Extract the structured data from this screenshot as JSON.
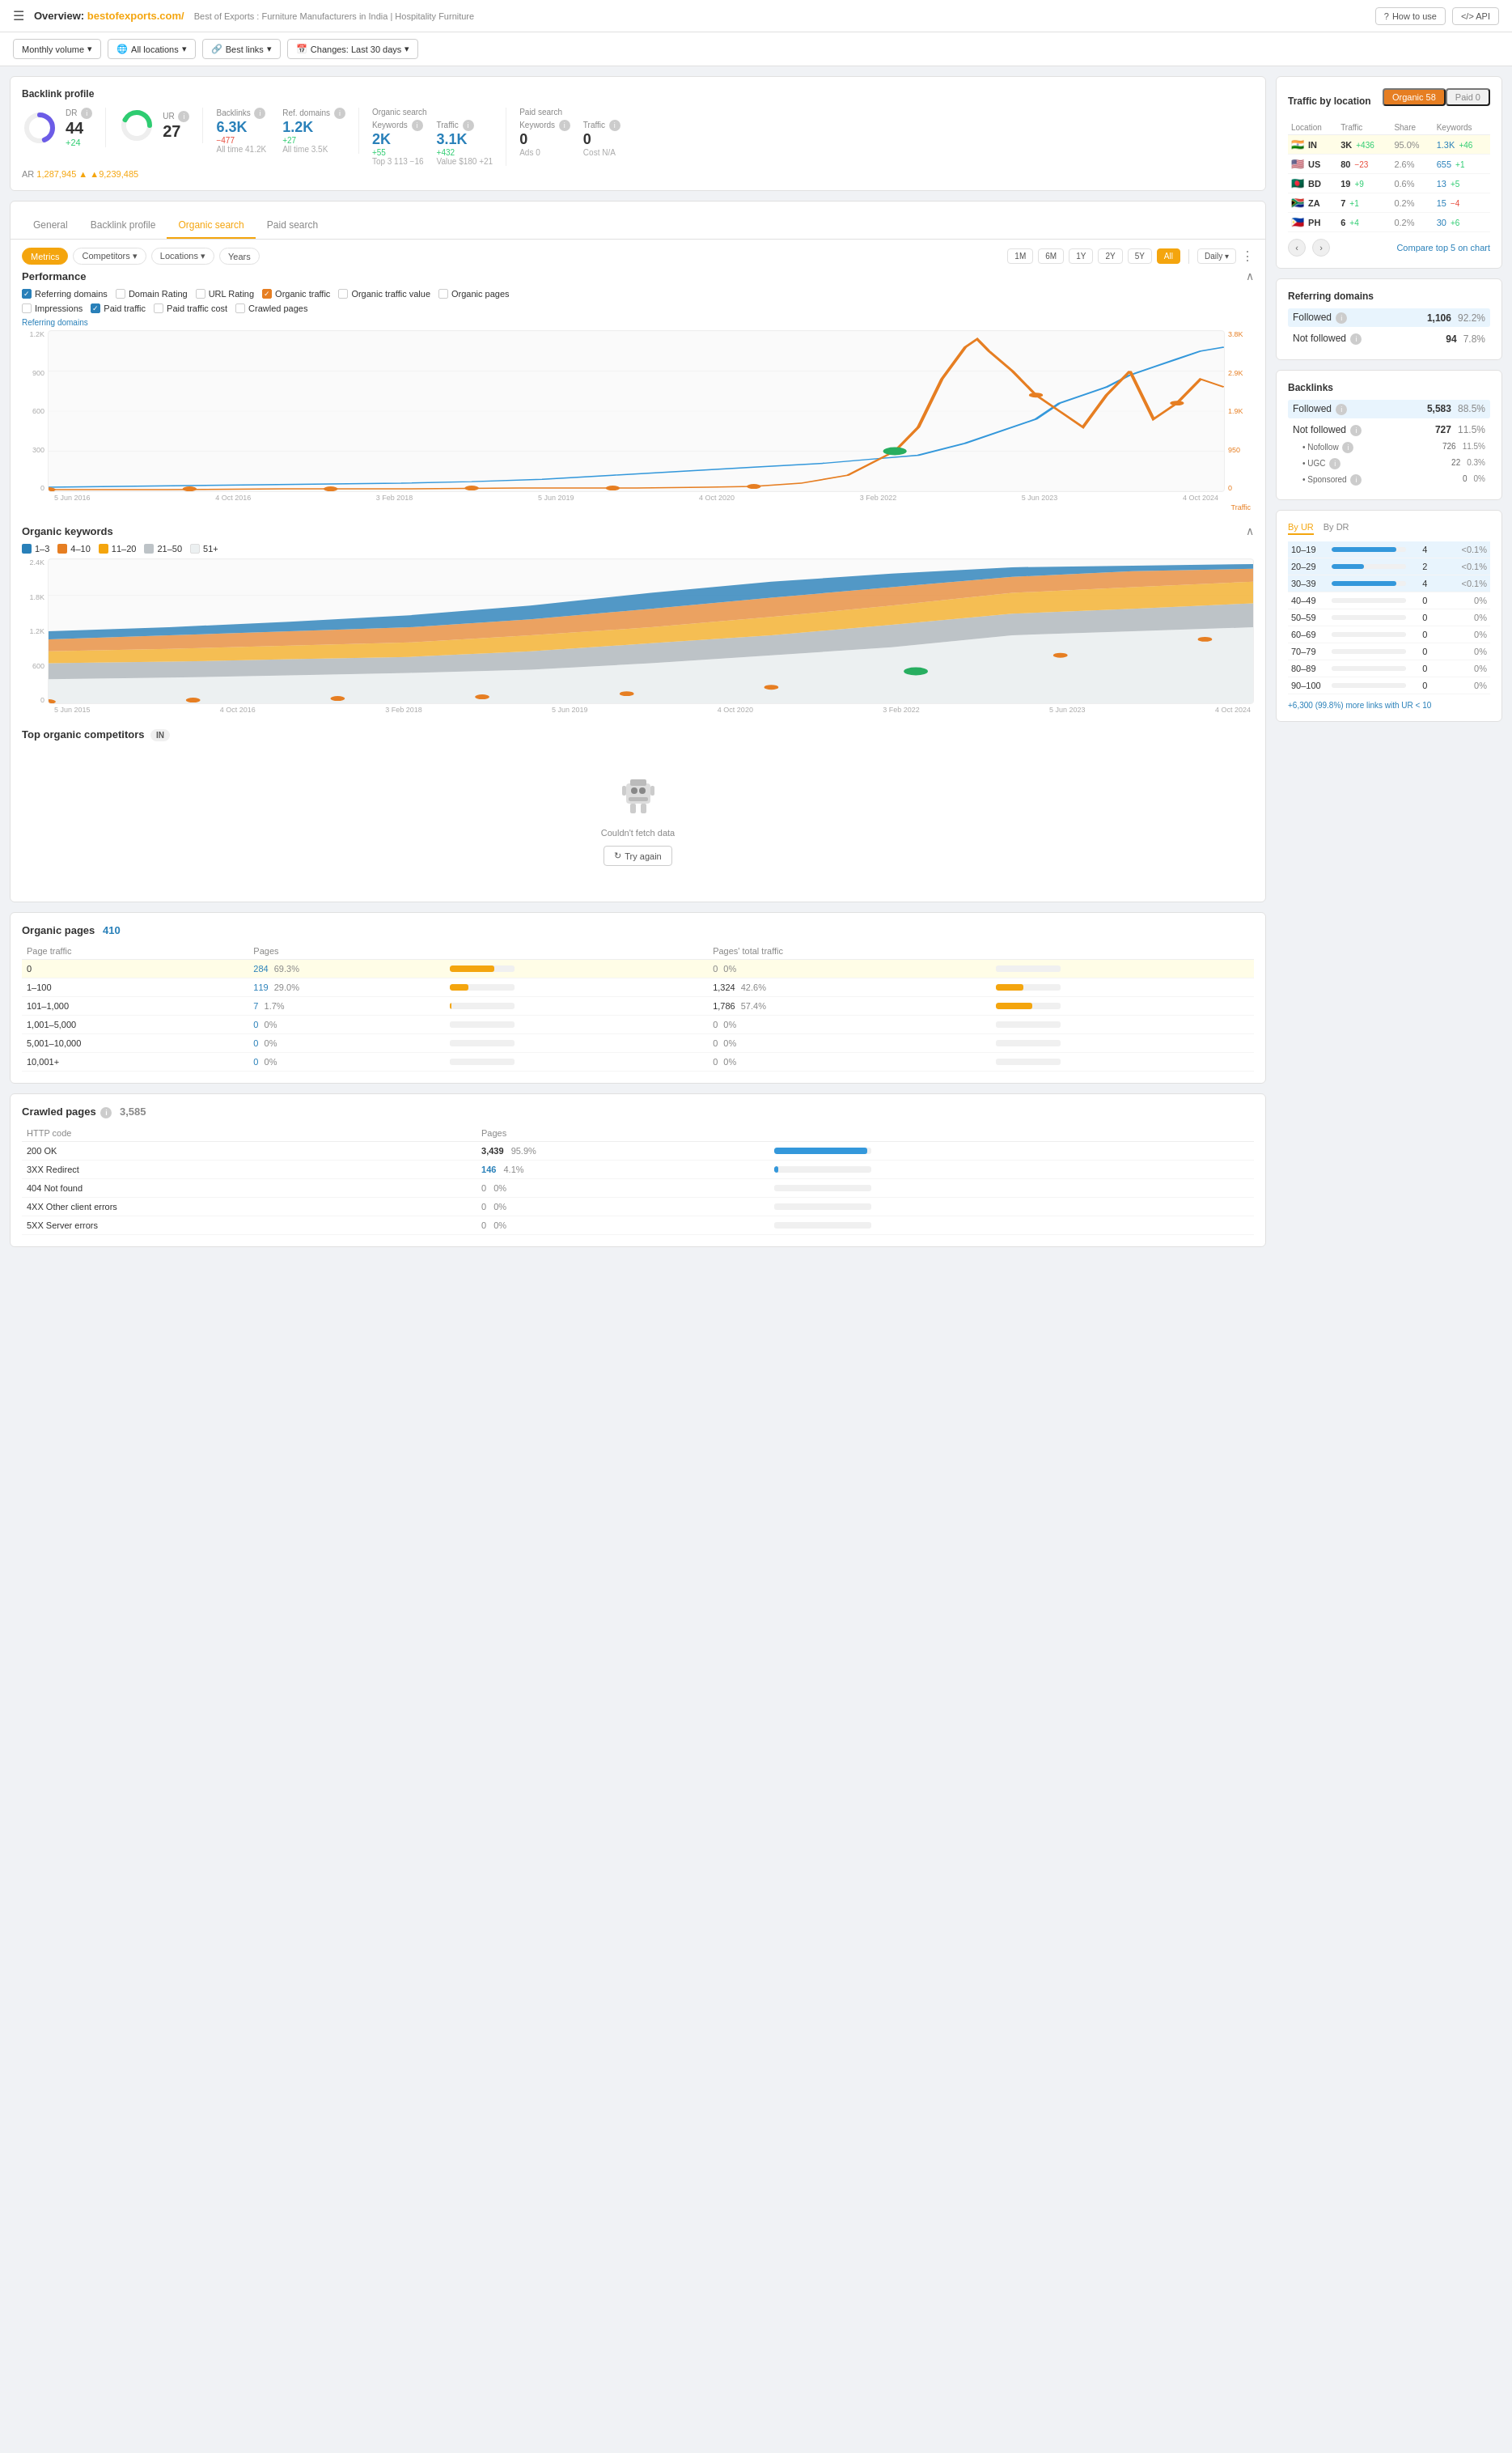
{
  "header": {
    "overview_label": "Overview:",
    "domain": "bestofexports.com/",
    "breadcrumb": "Best of Exports : Furniture Manufacturers in India | Hospitality Furniture",
    "how_to_use": "How to use",
    "api_label": "API"
  },
  "filters": {
    "monthly_volume": "Monthly volume",
    "all_locations": "All locations",
    "best_links": "Best links",
    "changes": "Changes: Last 30 days"
  },
  "backlink_profile": {
    "title": "Backlink profile",
    "dr_label": "DR",
    "dr_value": "44",
    "dr_change": "+24",
    "ur_label": "UR",
    "ur_value": "27",
    "ar_label": "AR",
    "ar_value": "1,287,945",
    "ar_change": "▲9,239,485",
    "backlinks_label": "Backlinks",
    "backlinks_value": "6.3K",
    "backlinks_change": "−477",
    "backlinks_alltime": "All time 41.2K",
    "ref_domains_label": "Ref. domains",
    "ref_domains_value": "1.2K",
    "ref_domains_change": "+27",
    "ref_domains_alltime": "All time 3.5K"
  },
  "organic_search": {
    "title": "Organic search",
    "keywords_label": "Keywords",
    "keywords_value": "2K",
    "keywords_change": "+55",
    "keywords_top3": "Top 3  113  −16",
    "traffic_label": "Traffic",
    "traffic_value": "3.1K",
    "traffic_change": "+432",
    "traffic_value_label": "Value $180  +21"
  },
  "paid_search": {
    "title": "Paid search",
    "keywords_label": "Keywords",
    "keywords_value": "0",
    "ads_label": "Ads 0",
    "traffic_label": "Traffic",
    "traffic_value": "0",
    "cost_label": "Cost N/A"
  },
  "tabs": [
    "General",
    "Backlink profile",
    "Organic search",
    "Paid search"
  ],
  "active_tab": "General",
  "chart_controls": {
    "period_buttons": [
      "1M",
      "6M",
      "1Y",
      "2Y",
      "5Y",
      "All"
    ],
    "active_period": "All",
    "freq_options": [
      "Daily"
    ],
    "pill_tabs": [
      "Metrics",
      "Competitors",
      "Locations",
      "Years"
    ],
    "active_pill": "Metrics"
  },
  "performance": {
    "title": "Performance",
    "checkboxes": [
      {
        "label": "Referring domains",
        "checked": true,
        "color": "blue"
      },
      {
        "label": "Domain Rating",
        "checked": false,
        "color": "gray"
      },
      {
        "label": "URL Rating",
        "checked": false,
        "color": "gray"
      },
      {
        "label": "Organic traffic",
        "checked": true,
        "color": "orange"
      },
      {
        "label": "Organic traffic value",
        "checked": false,
        "color": "gray"
      },
      {
        "label": "Organic pages",
        "checked": false,
        "color": "gray"
      },
      {
        "label": "Impressions",
        "checked": false,
        "color": "gray"
      },
      {
        "label": "Paid traffic",
        "checked": true,
        "color": "gray"
      },
      {
        "label": "Paid traffic cost",
        "checked": false,
        "color": "gray"
      },
      {
        "label": "Crawled pages",
        "checked": false,
        "color": "gray"
      }
    ],
    "y_axis_left": [
      "1.2K",
      "900",
      "600",
      "300",
      "0"
    ],
    "y_axis_right": [
      "3.8K",
      "2.9K",
      "1.9K",
      "950",
      "0"
    ],
    "x_axis": [
      "5 Jun 2016",
      "4 Oct 2016",
      "3 Feb 2018",
      "5 Jun 2019",
      "4 Oct 2020",
      "3 Feb 2022",
      "5 Jun 2023",
      "4 Oct 2024"
    ],
    "referring_label": "Referring domains",
    "traffic_label": "Traffic"
  },
  "organic_keywords": {
    "title": "Organic keywords",
    "legend": [
      {
        "label": "1–3",
        "color": "#2980b9"
      },
      {
        "label": "4–10",
        "color": "#e67e22"
      },
      {
        "label": "11–20",
        "color": "#f4a50e"
      },
      {
        "label": "21–50",
        "color": "#bdc3c7"
      },
      {
        "label": "51+",
        "color": "#ecf0f1"
      }
    ],
    "y_axis": [
      "2.4K",
      "1.8K",
      "1.2K",
      "600",
      "0"
    ],
    "x_axis": [
      "5 Jun 2015",
      "4 Oct 2016",
      "3 Feb 2018",
      "5 Jun 2019",
      "4 Oct 2020",
      "3 Feb 2022",
      "5 Jun 2023",
      "4 Oct 2024"
    ]
  },
  "top_competitors": {
    "title": "Top organic competitors",
    "location": "IN",
    "empty_message": "Couldn't fetch data",
    "try_again": "Try again"
  },
  "organic_pages": {
    "title": "Organic pages",
    "count": "410",
    "columns": [
      "Page traffic",
      "Pages",
      "",
      "Pages' total traffic",
      ""
    ],
    "rows": [
      {
        "traffic": "0",
        "pages": "284",
        "pages_pct": "69.3%",
        "total_traffic": "0",
        "total_pct": "0%",
        "bar_pages": 69,
        "bar_traffic": 0
      },
      {
        "traffic": "1–100",
        "pages": "119",
        "pages_pct": "29.0%",
        "total_traffic": "1,324",
        "total_pct": "42.6%",
        "bar_pages": 29,
        "bar_traffic": 43
      },
      {
        "traffic": "101–1,000",
        "pages": "7",
        "pages_pct": "1.7%",
        "total_traffic": "1,786",
        "total_pct": "57.4%",
        "bar_pages": 2,
        "bar_traffic": 57
      },
      {
        "traffic": "1,001–5,000",
        "pages": "0",
        "pages_pct": "0%",
        "total_traffic": "0",
        "total_pct": "0%",
        "bar_pages": 0,
        "bar_traffic": 0
      },
      {
        "traffic": "5,001–10,000",
        "pages": "0",
        "pages_pct": "0%",
        "total_traffic": "0",
        "total_pct": "0%",
        "bar_pages": 0,
        "bar_traffic": 0
      },
      {
        "traffic": "10,001+",
        "pages": "0",
        "pages_pct": "0%",
        "total_traffic": "0",
        "total_pct": "0%",
        "bar_pages": 0,
        "bar_traffic": 0
      }
    ]
  },
  "crawled_pages": {
    "title": "Crawled pages",
    "count": "3,585",
    "columns": [
      "HTTP code",
      "Pages",
      ""
    ],
    "rows": [
      {
        "code": "200 OK",
        "pages": "3,439",
        "pct": "95.9%",
        "bar": 96,
        "color": "#3498db"
      },
      {
        "code": "3XX Redirect",
        "pages": "146",
        "pct": "4.1%",
        "bar": 4,
        "color": "#3498db"
      },
      {
        "code": "404 Not found",
        "pages": "0",
        "pct": "0%",
        "bar": 0,
        "color": "#3498db"
      },
      {
        "code": "4XX Other client errors",
        "pages": "0",
        "pct": "0%",
        "bar": 0,
        "color": "#3498db"
      },
      {
        "code": "5XX Server errors",
        "pages": "0",
        "pct": "0%",
        "bar": 0,
        "color": "#3498db"
      }
    ]
  },
  "traffic_by_location": {
    "title": "Traffic by location",
    "tabs": [
      "Organic 58",
      "Paid 0"
    ],
    "active_tab": "Organic 58",
    "columns": [
      "Location",
      "Traffic",
      "Share",
      "Keywords"
    ],
    "rows": [
      {
        "country": "IN",
        "flag": "🇮🇳",
        "traffic": "3K",
        "change": "+436",
        "share": "95.0%",
        "keywords": "1.3K",
        "kw_change": "+46",
        "highlighted": true
      },
      {
        "country": "US",
        "flag": "🇺🇸",
        "traffic": "80",
        "change": "−23",
        "share": "2.6%",
        "keywords": "655",
        "kw_change": "+1",
        "highlighted": false
      },
      {
        "country": "BD",
        "flag": "🇧🇩",
        "traffic": "19",
        "change": "+9",
        "share": "0.6%",
        "keywords": "13",
        "kw_change": "+5",
        "highlighted": false
      },
      {
        "country": "ZA",
        "flag": "🇿🇦",
        "traffic": "7",
        "change": "+1",
        "share": "0.2%",
        "keywords": "15",
        "kw_change": "−4",
        "highlighted": false
      },
      {
        "country": "PH",
        "flag": "🇵🇭",
        "traffic": "6",
        "change": "+4",
        "share": "0.2%",
        "keywords": "30",
        "kw_change": "+6",
        "highlighted": false
      }
    ],
    "compare_label": "Compare top 5 on chart"
  },
  "referring_domains": {
    "title": "Referring domains",
    "followed_label": "Followed",
    "followed_value": "1,106",
    "followed_pct": "92.2%",
    "not_followed_label": "Not followed",
    "not_followed_value": "94",
    "not_followed_pct": "7.8%"
  },
  "backlinks": {
    "title": "Backlinks",
    "followed_value": "5,583",
    "followed_pct": "88.5%",
    "not_followed_value": "727",
    "not_followed_pct": "11.5%",
    "nofollow_value": "726",
    "nofollow_pct": "11.5%",
    "ugc_value": "22",
    "ugc_pct": "0.3%",
    "sponsored_value": "0",
    "sponsored_pct": "0%"
  },
  "by_ur": {
    "title_ur": "By UR",
    "title_dr": "By DR",
    "rows": [
      {
        "range": "10–19",
        "value": "4",
        "pct": "<0.1%",
        "bar": 4
      },
      {
        "range": "20–29",
        "value": "2",
        "pct": "<0.1%",
        "bar": 2
      },
      {
        "range": "30–39",
        "value": "4",
        "pct": "<0.1%",
        "bar": 4
      },
      {
        "range": "40–49",
        "value": "0",
        "pct": "0%",
        "bar": 0
      },
      {
        "range": "50–59",
        "value": "0",
        "pct": "0%",
        "bar": 0
      },
      {
        "range": "60–69",
        "value": "0",
        "pct": "0%",
        "bar": 0
      },
      {
        "range": "70–79",
        "value": "0",
        "pct": "0%",
        "bar": 0
      },
      {
        "range": "80–89",
        "value": "0",
        "pct": "0%",
        "bar": 0
      },
      {
        "range": "90–100",
        "value": "0",
        "pct": "0%",
        "bar": 0
      }
    ],
    "footnote": "+6,300 (99.8%) more links with UR < 10"
  }
}
